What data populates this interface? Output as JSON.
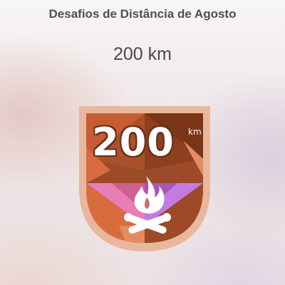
{
  "header": {
    "title": "Desafios de Distância de Agosto",
    "distance": "200 km"
  },
  "badge": {
    "number": "200",
    "unit": "km",
    "icon": "campfire-icon",
    "colors": {
      "rim": "#e8b79d",
      "dark": "#7a3516",
      "brown": "#9c4a27",
      "orange": "#d96c3f",
      "peach": "#e38b63",
      "pink": "#e77eb8",
      "purple": "#c47be0"
    }
  }
}
